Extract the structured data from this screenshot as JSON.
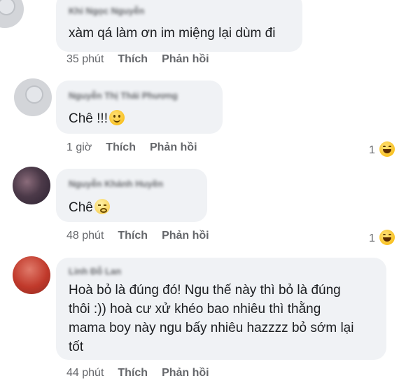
{
  "comments": [
    {
      "author": "Khi Ngọc Nguyễn",
      "text_lines": [
        "xàm qá làm ơn im miệng lại dùm đi"
      ],
      "time": "35 phút",
      "like": "Thích",
      "reply": "Phản hồi"
    },
    {
      "author": "Nguyễn Thị Thái Phương",
      "text_lines": [
        "Chê !!!"
      ],
      "emoji": "slightly-smiling-face-icon",
      "time": "1 giờ",
      "like": "Thích",
      "reply": "Phản hồi",
      "reaction_count": "1",
      "reaction_icon": "laughing-face-icon"
    },
    {
      "author": "Nguyễn Khánh Huyền",
      "text_lines": [
        "Chê"
      ],
      "emoji": "woozy-face-icon",
      "time": "48 phút",
      "like": "Thích",
      "reply": "Phản hồi",
      "reaction_count": "1",
      "reaction_icon": "laughing-face-icon"
    },
    {
      "author": "Linh Đỗ Lan",
      "text_lines": [
        "Hoà bỏ là đúng đó! Ngu thế này thì bỏ là đúng",
        "thôi :)) hoà cư xử khéo bao nhiêu thì thằng",
        "mama boy này ngu bấy nhiêu hazzzz bỏ sớm lại",
        "tốt"
      ],
      "time": "44 phút",
      "like": "Thích",
      "reply": "Phản hồi"
    }
  ]
}
